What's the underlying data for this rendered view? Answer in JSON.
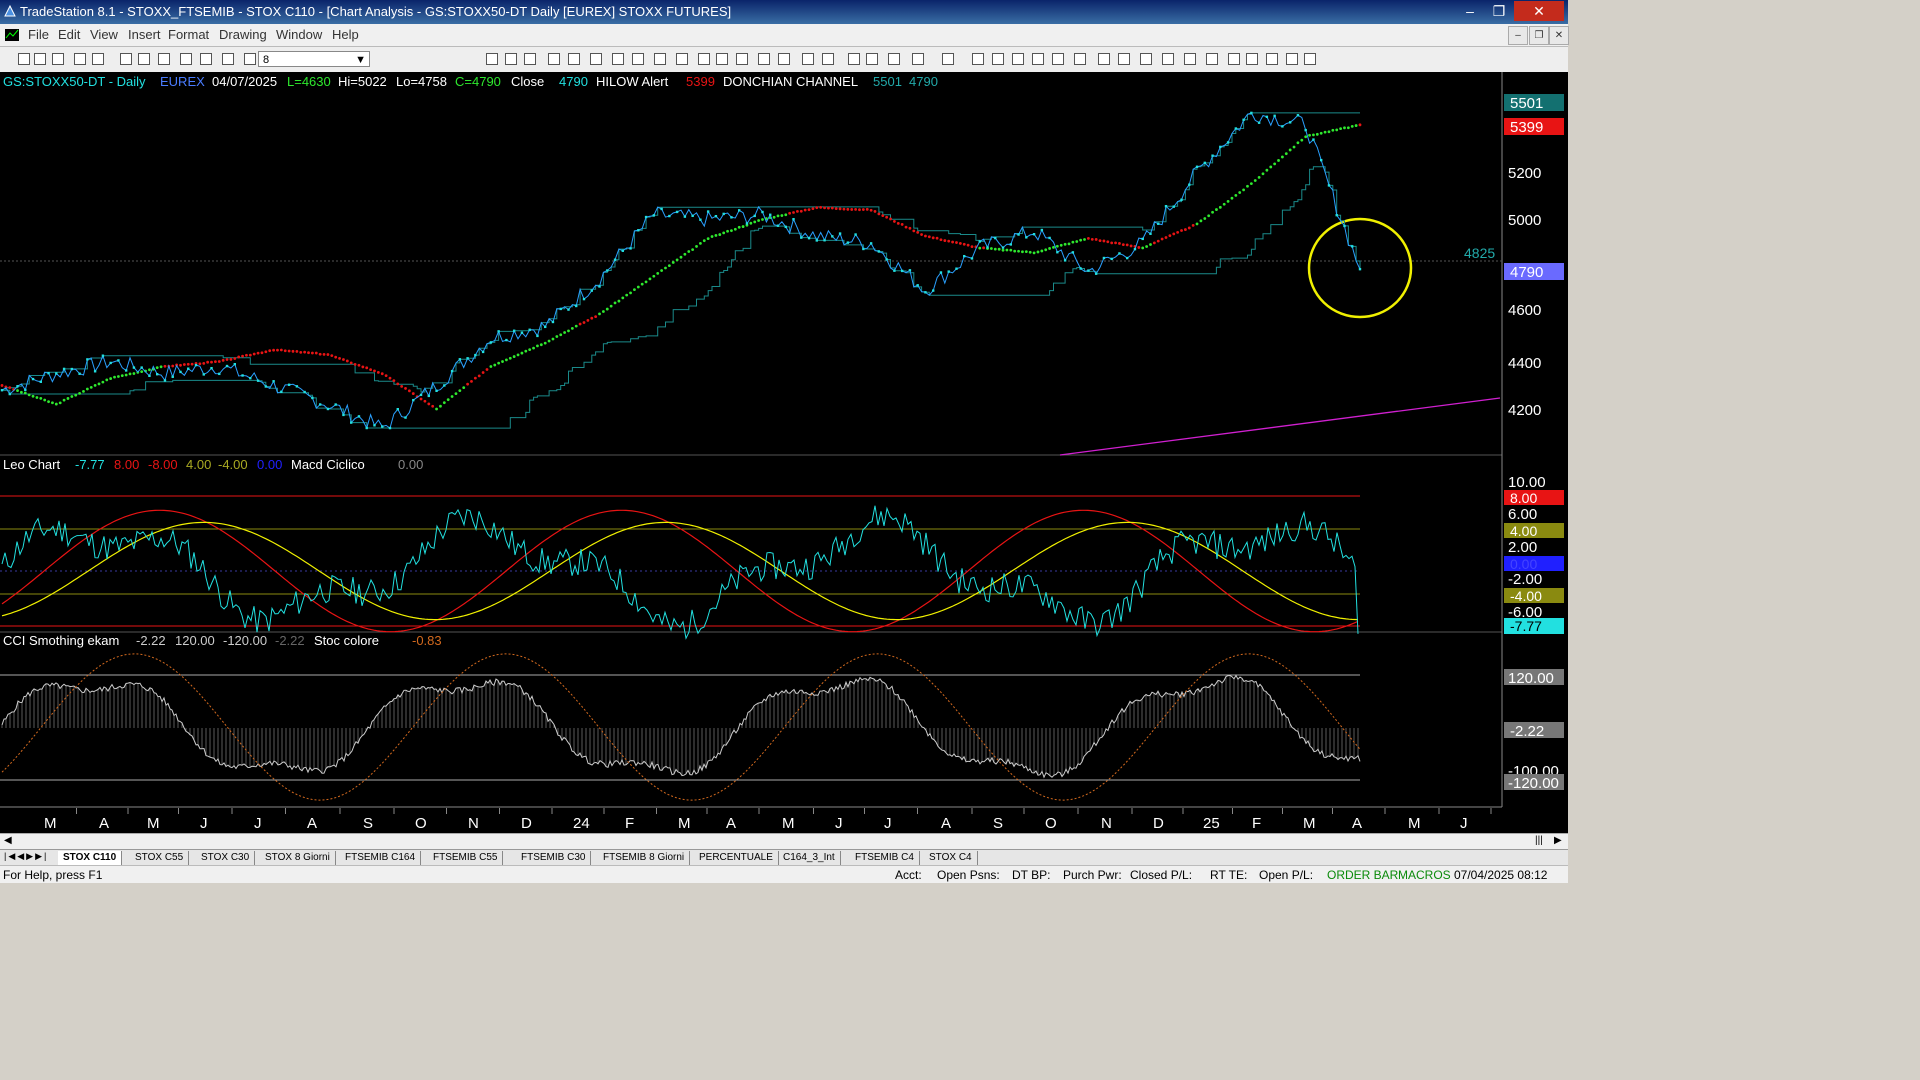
{
  "window": {
    "title": "TradeStation 8.1 - STOXX_FTSEMIB - STOX C110 - [Chart Analysis - GS:STOXX50-DT  Daily  [EUREX] STOXX FUTURES]"
  },
  "menu": [
    "File",
    "Edit",
    "View",
    "Insert",
    "Format",
    "Drawing",
    "Window",
    "Help"
  ],
  "toolbar": {
    "interval_value": "8"
  },
  "chart": {
    "header": {
      "symbol": "GS:STOXX50-DT - Daily",
      "exchange": "EUREX",
      "date": "04/07/2025",
      "low_open": "L=4630",
      "hi": "Hi=5022",
      "lo": "Lo=4758",
      "close_val": "C=4790",
      "close_label": "Close",
      "close_num": "4790",
      "hilow": "HILOW Alert",
      "hilow_val": "5399",
      "donchian": "DONCHIAN CHANNEL",
      "don_hi": "5501",
      "don_lo": "4790"
    },
    "price_axis": [
      "5200",
      "5000",
      "4800",
      "4600",
      "4400",
      "4200"
    ],
    "price_badges": {
      "top": "5501",
      "red": "5399",
      "last": "4790",
      "crosshair": "4825"
    },
    "pane2": {
      "name": "Leo Chart",
      "v1": "-7.77",
      "v2": "8.00",
      "v3": "-8.00",
      "v4": "4.00",
      "v5": "-4.00",
      "v6": "0.00",
      "name2": "Macd Ciclico",
      "v7": "0.00"
    },
    "pane2_axis": [
      "10.00",
      "6.00",
      "2.00",
      "-2.00",
      "-6.00"
    ],
    "pane2_badges": {
      "b8": "8.00",
      "b4": "4.00",
      "b0": "0.00",
      "bm4": "-4.00",
      "last": "-7.77"
    },
    "pane3": {
      "name": "CCI Smothing ekam",
      "v1": "-2.22",
      "v2": "120.00",
      "v3": "-120.00",
      "v4": "-2.22",
      "name2": "Stoc colore",
      "v5": "-0.83"
    },
    "pane3_badges": {
      "top": "120.00",
      "mid": "-2.22",
      "lo1": "-100.00",
      "lo2": "-120.00"
    },
    "x_axis": [
      "M",
      "A",
      "M",
      "J",
      "J",
      "A",
      "S",
      "O",
      "N",
      "D",
      "24",
      "F",
      "M",
      "A",
      "M",
      "J",
      "J",
      "A",
      "S",
      "O",
      "N",
      "D",
      "25",
      "F",
      "M",
      "A",
      "M",
      "J"
    ]
  },
  "chart_data": {
    "type": "line",
    "title": "GS:STOXX50-DT - Daily",
    "ylim": [
      4050,
      5600
    ],
    "x": [
      "2023-03",
      "2023-04",
      "2023-05",
      "2023-06",
      "2023-07",
      "2023-08",
      "2023-09",
      "2023-10",
      "2023-11",
      "2023-12",
      "2024-01",
      "2024-02",
      "2024-03",
      "2024-04",
      "2024-05",
      "2024-06",
      "2024-07",
      "2024-08",
      "2024-09",
      "2024-10",
      "2024-11",
      "2024-12",
      "2025-01",
      "2025-02",
      "2025-03",
      "2025-04"
    ],
    "series": [
      {
        "name": "Close",
        "values": [
          4280,
          4350,
          4400,
          4350,
          4380,
          4300,
          4220,
          4120,
          4300,
          4500,
          4550,
          4750,
          5020,
          5000,
          5020,
          4930,
          4900,
          4700,
          4880,
          4950,
          4780,
          4900,
          5200,
          5450,
          5400,
          4790
        ]
      },
      {
        "name": "HILOW Alert",
        "values": [
          4300,
          4220,
          4330,
          4380,
          4400,
          4450,
          4430,
          4350,
          4200,
          4380,
          4480,
          4600,
          4760,
          4920,
          5000,
          5050,
          5040,
          4930,
          4880,
          4860,
          4920,
          4880,
          4980,
          5150,
          5350,
          5399
        ]
      }
    ],
    "tabs": [
      "STOX C110",
      "STOX C55",
      "STOX  C30",
      "STOX  8 Giorni",
      "FTSEMIB C164",
      "FTSEMIB C55",
      "FTSEMIB C30",
      "FTSEMIB  8 Giorni",
      "PERCENTUALE",
      "C164_3_Int",
      "FTSEMIB C4",
      "STOX  C4"
    ],
    "status": {
      "help": "For Help, press F1",
      "acct": "Acct:",
      "psns": "Open Psns:",
      "dtbp": "DT BP:",
      "purch": "Purch Pwr:",
      "closedpl": "Closed P/L:",
      "rtte": "RT TE:",
      "openpl": "Open P/L:",
      "orderbar": "ORDER BAR",
      "macros": "MACROS",
      "datetime": "07/04/2025 08:12"
    },
    "colors": {
      "cyan": "#22e0e0",
      "red": "#e81414",
      "green": "#2ee82e",
      "yellow": "#f0f000",
      "magenta": "#d020d0",
      "blue": "#2020ff"
    }
  }
}
